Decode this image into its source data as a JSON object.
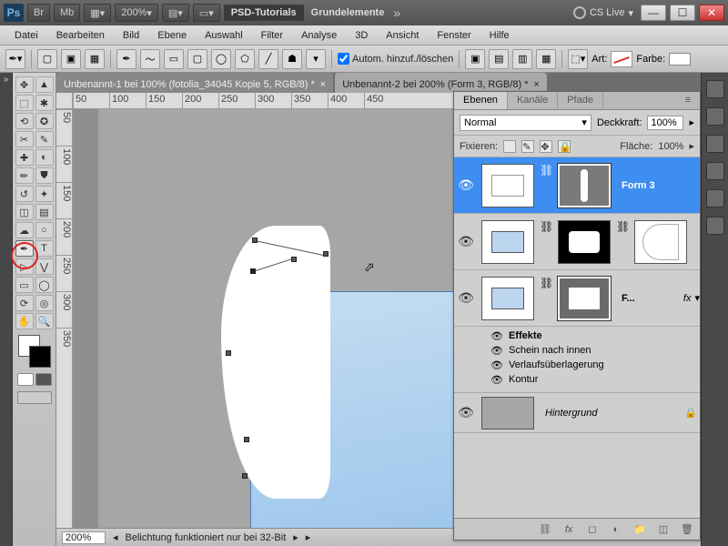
{
  "titlebar": {
    "ps": "Ps",
    "br": "Br",
    "mb": "Mb",
    "zoom": "200%",
    "tutorials": "PSD-Tutorials",
    "docgroup": "Grundelemente",
    "cslive": "CS Live"
  },
  "menu": [
    "Datei",
    "Bearbeiten",
    "Bild",
    "Ebene",
    "Auswahl",
    "Filter",
    "Analyse",
    "3D",
    "Ansicht",
    "Fenster",
    "Hilfe"
  ],
  "options": {
    "auto_add": "Autom. hinzuf./löschen",
    "art": "Art:",
    "farbe": "Farbe:"
  },
  "tabs": [
    "Unbenannt-1 bei 100% (fotolia_34045 Kopie 5, RGB/8) *",
    "Unbenannt-2 bei 200% (Form 3, RGB/8) *"
  ],
  "ruler_h": [
    "50",
    "100",
    "150",
    "200",
    "250",
    "300",
    "350",
    "400",
    "450"
  ],
  "ruler_v": [
    "50",
    "100",
    "150",
    "200",
    "250",
    "300",
    "350"
  ],
  "status": {
    "zoom": "200%",
    "msg": "Belichtung funktioniert nur bei 32-Bit"
  },
  "panel": {
    "tabs": [
      "Ebenen",
      "Kanäle",
      "Pfade"
    ],
    "blend": "Normal",
    "opacity_label": "Deckkraft:",
    "opacity": "100%",
    "fix": "Fixieren:",
    "fill_label": "Fläche:",
    "fill": "100%",
    "layers": [
      {
        "name": "Form 3"
      },
      {
        "name": ""
      },
      {
        "name": "F...",
        "fx": "fx"
      }
    ],
    "effects_title": "Effekte",
    "effects": [
      "Schein nach innen",
      "Verlaufsüberlagerung",
      "Kontur"
    ],
    "bg": "Hintergrund"
  }
}
